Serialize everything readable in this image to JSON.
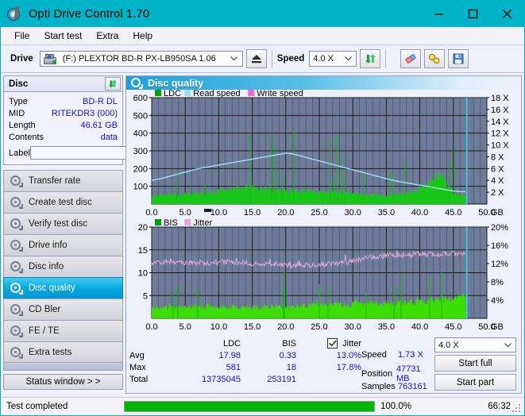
{
  "window": {
    "title": "Opti Drive Control 1.70",
    "icon": "optical-disc-icon",
    "minimize": "minimize",
    "maximize": "maximize",
    "close": "close"
  },
  "menu": {
    "items": [
      "File",
      "Start test",
      "Extra",
      "Help"
    ]
  },
  "toolbar": {
    "drive_label": "Drive",
    "drive_value": "(F:)  PLEXTOR BD-R  PX-LB950SA 1.06",
    "eject_icon": "eject-icon",
    "speed_label": "Speed",
    "speed_value": "4.0 X",
    "refresh_icon": "refresh-icon",
    "erase_icon": "eraser-icon",
    "tools_icon": "tools-icon",
    "save_icon": "save-icon"
  },
  "disc": {
    "header": "Disc",
    "refresh_icon": "refresh-icon",
    "rows": [
      {
        "key": "Type",
        "value": "BD-R DL"
      },
      {
        "key": "MID",
        "value": "RITEKDR3 (000)"
      },
      {
        "key": "Length",
        "value": "46.61 GB"
      },
      {
        "key": "Contents",
        "value": "data"
      }
    ],
    "label_key": "Label",
    "label_value": "",
    "label_placeholder": "",
    "disc_button_icon": "cd-icon"
  },
  "nav": {
    "items": [
      {
        "label": "Transfer rate",
        "selected": false
      },
      {
        "label": "Create test disc",
        "selected": false
      },
      {
        "label": "Verify test disc",
        "selected": false
      },
      {
        "label": "Drive info",
        "selected": false
      },
      {
        "label": "Disc info",
        "selected": false
      },
      {
        "label": "Disc quality",
        "selected": true
      },
      {
        "label": "CD Bler",
        "selected": false
      },
      {
        "label": "FE / TE",
        "selected": false
      },
      {
        "label": "Extra tests",
        "selected": false
      }
    ],
    "status_window": "Status window > >"
  },
  "panel": {
    "title": "Disc quality",
    "icon": "disc-quality-icon"
  },
  "chart_data": [
    {
      "type": "area",
      "id": "ldc-chart",
      "title": "",
      "xlabel": "GB",
      "ylabel": "",
      "legend": [
        {
          "label": "LDC",
          "color": "#00a000"
        },
        {
          "label": "Read speed",
          "color": "#9fd9f2"
        },
        {
          "label": "Write speed",
          "color": "#f562d8"
        }
      ],
      "legend_position": "top-left",
      "grid": true,
      "xlim": [
        0.0,
        50.0
      ],
      "xticks": [
        "0.0",
        "5.0",
        "10.0",
        "15.0",
        "20.0",
        "25.0",
        "30.0",
        "35.0",
        "40.0",
        "45.0",
        "50.0"
      ],
      "xtick_suffix": "GB",
      "ylim": [
        0,
        600
      ],
      "yticks": [
        100,
        200,
        300,
        400,
        500,
        600
      ],
      "y2lim": [
        0,
        18
      ],
      "y2ticks": [
        "2 X",
        "4 X",
        "6 X",
        "8 X",
        "10 X",
        "12 X",
        "14 X",
        "16 X",
        "18 X"
      ],
      "series": [
        {
          "name": "LDC",
          "color": "#18c818",
          "kind": "spikes",
          "x_end": 47.0,
          "baseline": [
            50,
            48,
            52,
            55,
            58,
            60,
            62,
            65,
            68,
            70,
            74,
            80,
            86,
            92,
            96,
            98,
            96,
            92,
            88,
            84,
            80,
            78,
            76,
            74,
            72,
            70,
            68,
            66,
            64,
            62,
            60,
            58,
            56,
            54,
            52,
            52,
            54,
            58,
            64,
            74,
            88,
            110,
            140,
            175,
            120,
            70,
            48
          ]
        },
        {
          "name": "Read speed",
          "color": "#a6dcf5",
          "kind": "line",
          "x_end": 47.0,
          "values_x": [
            4.0,
            4.2,
            4.5,
            4.8,
            5.1,
            5.4,
            5.7,
            6.0,
            6.2,
            6.4,
            6.6,
            6.8,
            7.0,
            7.2,
            7.4,
            7.6,
            7.8,
            8.0,
            8.2,
            8.4,
            8.6,
            8.5,
            8.2,
            7.9,
            7.6,
            7.3,
            7.0,
            6.7,
            6.4,
            6.1,
            5.8,
            5.5,
            5.2,
            4.9,
            4.6,
            4.3,
            4.0,
            3.8,
            3.6,
            3.4,
            3.2,
            3.0,
            2.8,
            2.6,
            2.4,
            2.2,
            2.1
          ]
        }
      ],
      "cursor_x": 47.0,
      "cursor_color": "#35d0f0"
    },
    {
      "type": "area",
      "id": "bis-jitter-chart",
      "title": "",
      "xlabel": "GB",
      "legend": [
        {
          "label": "BIS",
          "color": "#00a000"
        },
        {
          "label": "Jitter",
          "color": "#dda8dd"
        }
      ],
      "legend_position": "top-left",
      "grid": true,
      "xlim": [
        0.0,
        50.0
      ],
      "xticks": [
        "0.0",
        "5.0",
        "10.0",
        "15.0",
        "20.0",
        "25.0",
        "30.0",
        "35.0",
        "40.0",
        "45.0",
        "50.0"
      ],
      "xtick_suffix": "GB",
      "ylim": [
        0,
        20
      ],
      "yticks": [
        5,
        10,
        15,
        20
      ],
      "y2lim": [
        0,
        20
      ],
      "y2ticks": [
        "4%",
        "8%",
        "12%",
        "16%",
        "20%"
      ],
      "series": [
        {
          "name": "BIS",
          "color": "#3ade00",
          "kind": "spikes",
          "x_end": 47.0,
          "baseline": [
            2.6,
            2.5,
            2.6,
            2.7,
            2.6,
            2.5,
            2.6,
            2.8,
            2.7,
            2.6,
            2.5,
            2.6,
            2.7,
            2.6,
            2.5,
            2.6,
            2.5,
            2.6,
            2.7,
            2.6,
            2.5,
            2.6,
            2.7,
            3.0,
            3.2,
            3.1,
            3.0,
            3.2,
            3.1,
            3.0,
            3.2,
            3.3,
            3.2,
            3.4,
            3.3,
            3.5,
            3.4,
            3.6,
            3.5,
            3.8,
            3.9,
            4.0,
            4.2,
            4.4,
            4.6,
            5.0,
            4.8
          ]
        },
        {
          "name": "Jitter",
          "color": "#dda8dd",
          "kind": "noise-line",
          "x_end": 47.0,
          "values": [
            11.9,
            12.1,
            12.3,
            12.4,
            12.3,
            12.2,
            12.1,
            12.2,
            12.1,
            12.0,
            12.2,
            12.3,
            12.2,
            12.1,
            12.0,
            11.9,
            11.8,
            11.9,
            11.8,
            11.7,
            11.6,
            11.5,
            11.6,
            11.5,
            11.6,
            11.7,
            11.8,
            11.9,
            12.0,
            12.2,
            12.5,
            12.8,
            13.1,
            13.4,
            13.5,
            13.6,
            13.7,
            13.8,
            13.8,
            13.9,
            14.0,
            14.0,
            14.1,
            14.0,
            14.1,
            14.2,
            14.0
          ]
        }
      ],
      "cursor_x": 47.0,
      "cursor_color": "#35d0f0"
    }
  ],
  "stats": {
    "col_headers": [
      "LDC",
      "BIS"
    ],
    "jitter_header": "Jitter",
    "jitter_checked": true,
    "rows": [
      {
        "key": "Avg",
        "ldc": "17.98",
        "bis": "0.33",
        "jitter": "13.0%"
      },
      {
        "key": "Max",
        "ldc": "581",
        "bis": "18",
        "jitter": "17.8%"
      },
      {
        "key": "Total",
        "ldc": "13735045",
        "bis": "253191",
        "jitter": ""
      }
    ]
  },
  "run": {
    "speed_key": "Speed",
    "speed_value": "1.73 X",
    "position_key": "Position",
    "position_value": "47731 MB",
    "samples_key": "Samples",
    "samples_value": "763161",
    "speed_select": "4.0 X",
    "start_full": "Start full",
    "start_part": "Start part"
  },
  "statusbar": {
    "text": "Test completed",
    "progress_pct": 100.0,
    "progress_label": "100.0%",
    "elapsed": "66:32"
  },
  "colors": {
    "titlebar": "#00b3c6",
    "accent": "#1212d0",
    "plot_bg": "#6f7c99",
    "green": "#18c818",
    "jitter": "#dda8dd",
    "readspeed": "#a6dcf5",
    "cursor": "#35d0f0",
    "progress": "#00b400"
  }
}
